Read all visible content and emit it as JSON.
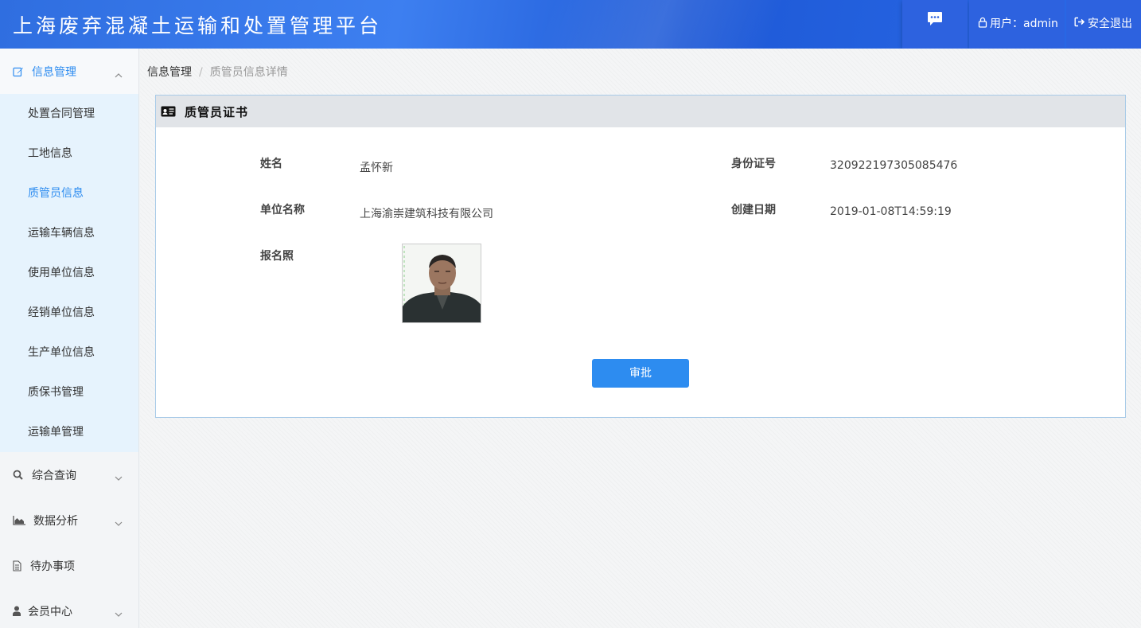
{
  "header": {
    "app_title": "上海废弃混凝土运输和处置管理平台",
    "user_text": "用户：admin",
    "logout_label": "安全退出",
    "icons": {
      "message": "message-icon",
      "user": "lock-user-icon",
      "logout": "sign-out-icon"
    }
  },
  "sidebar": {
    "groups": [
      {
        "label": "信息管理",
        "icon": "edit-icon",
        "expanded": true,
        "items": [
          {
            "label": "处置合同管理"
          },
          {
            "label": "工地信息"
          },
          {
            "label": "质管员信息",
            "active": true
          },
          {
            "label": "运输车辆信息"
          },
          {
            "label": "使用单位信息"
          },
          {
            "label": "经销单位信息"
          },
          {
            "label": "生产单位信息"
          },
          {
            "label": "质保书管理"
          },
          {
            "label": "运输单管理"
          }
        ]
      },
      {
        "label": "综合查询",
        "icon": "search-icon"
      },
      {
        "label": "数据分析",
        "icon": "area-chart-icon"
      },
      {
        "label": "待办事项",
        "icon": "file-icon"
      },
      {
        "label": "会员中心",
        "icon": "user-icon"
      }
    ]
  },
  "breadcrumb": {
    "parent": "信息管理",
    "separator": "/",
    "current": "质管员信息详情"
  },
  "panel": {
    "title": "质管员证书",
    "icon": "id-card-icon",
    "fields": {
      "name_label": "姓名",
      "name_value": "孟怀新",
      "id_label": "身份证号",
      "id_value": "320922197305085476",
      "unit_label": "单位名称",
      "unit_value": "上海渝崇建筑科技有限公司",
      "date_label": "创建日期",
      "date_value": "2019-01-08T14:59:19",
      "photo_label": "报名照"
    },
    "approve_label": "审批"
  },
  "colors": {
    "primary": "#2d8cf0",
    "header_blue": "#2d62df",
    "submenu_bg": "#e6f3fd"
  }
}
